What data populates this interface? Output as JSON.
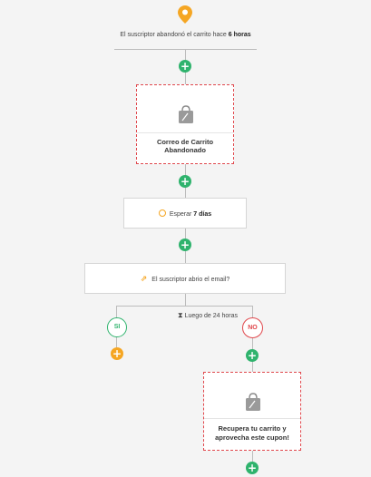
{
  "trigger": {
    "text_prefix": "El suscriptor abandonó el carrito hace",
    "text_emphasis": "6 horas"
  },
  "email_1": {
    "line1": "Correo de Carrito",
    "line2": "Abandonado"
  },
  "wait": {
    "label": "Esperar",
    "value": "7 días"
  },
  "condition": {
    "label": "El suscriptor abrio el email?",
    "timer_label": "Luego de 24 horas"
  },
  "branches": {
    "yes_label": "SI",
    "no_label": "NO"
  },
  "email_2": {
    "line1": "Recupera tu carrito y",
    "line2": "aprovecha este cupon!"
  },
  "plus_symbol": "+",
  "colors": {
    "accent_green": "#2fb36d",
    "accent_orange": "#f5a623",
    "no_red": "#e0474c",
    "dashed_border": "#e0474c"
  }
}
